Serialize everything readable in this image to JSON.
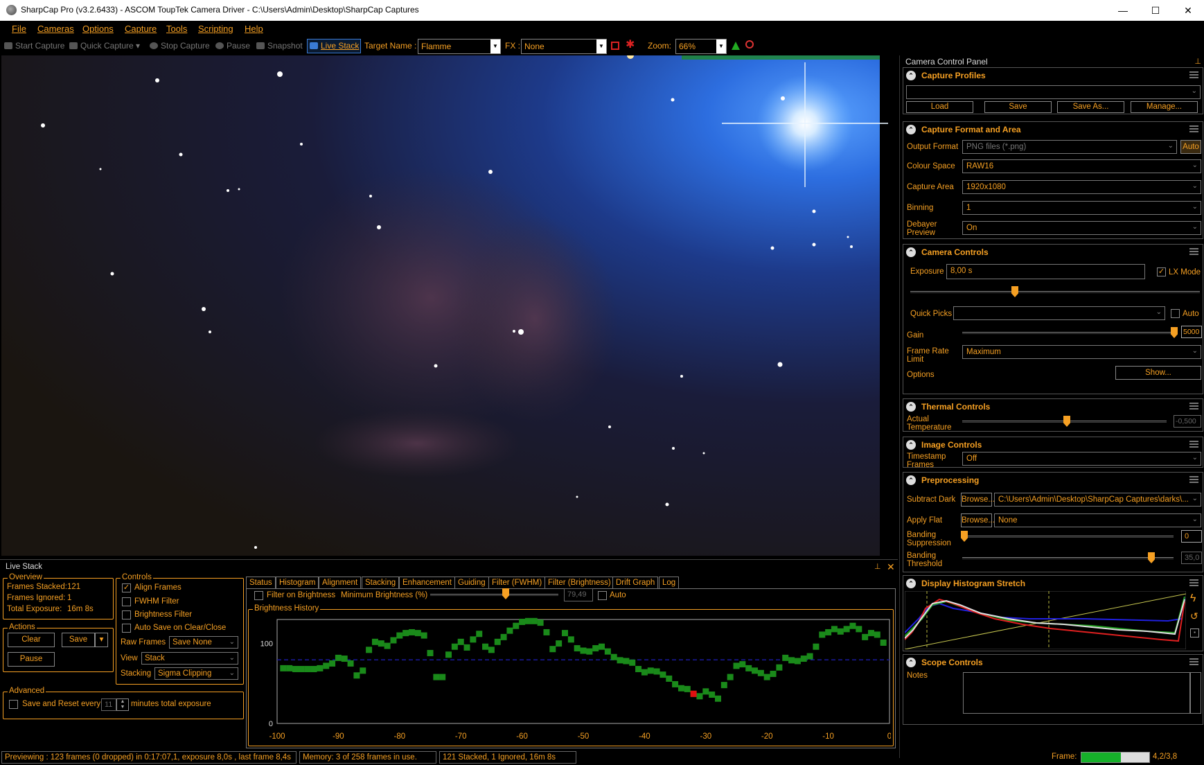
{
  "window": {
    "title": "SharpCap Pro (v3.2.6433) - ASCOM ToupTek Camera Driver - C:\\Users\\Admin\\Desktop\\SharpCap Captures",
    "minimize": "—",
    "maximize": "☐",
    "close": "✕"
  },
  "menu": [
    "File",
    "Cameras",
    "Options",
    "Capture",
    "Tools",
    "Scripting",
    "Help"
  ],
  "toolbar": {
    "start_capture": "Start Capture",
    "quick_capture": "Quick Capture",
    "stop_capture": "Stop Capture",
    "pause": "Pause",
    "snapshot": "Snapshot",
    "live_stack": "Live Stack",
    "target_name_label": "Target Name :",
    "target_name_value": "Flamme",
    "fx_label": "FX :",
    "fx_value": "None",
    "zoom_label": "Zoom:",
    "zoom_value": "66%"
  },
  "right_panel": {
    "title": "Camera Control Panel",
    "capture_profiles": {
      "title": "Capture Profiles",
      "load": "Load",
      "save": "Save",
      "save_as": "Save As...",
      "manage": "Manage..."
    },
    "capture_format": {
      "title": "Capture Format and Area",
      "output_format_label": "Output Format",
      "output_format_value": "PNG files (*.png)",
      "auto": "Auto",
      "colour_space_label": "Colour Space",
      "colour_space_value": "RAW16",
      "capture_area_label": "Capture Area",
      "capture_area_value": "1920x1080",
      "binning_label": "Binning",
      "binning_value": "1",
      "debayer_label": "Debayer Preview",
      "debayer_value": "On"
    },
    "camera_controls": {
      "title": "Camera Controls",
      "exposure_label": "Exposure",
      "exposure_value": "8,00 s",
      "lx_mode": "LX Mode",
      "quick_picks_label": "Quick Picks",
      "auto": "Auto",
      "gain_label": "Gain",
      "gain_value": "5000",
      "frame_rate_label": "Frame Rate Limit",
      "frame_rate_value": "Maximum",
      "options_label": "Options",
      "show_button": "Show..."
    },
    "thermal": {
      "title": "Thermal Controls",
      "temp_label": "Actual Temperature",
      "temp_value": "-0,500"
    },
    "image_controls": {
      "title": "Image Controls",
      "timestamp_label": "Timestamp Frames",
      "timestamp_value": "Off"
    },
    "preprocessing": {
      "title": "Preprocessing",
      "subtract_dark_label": "Subtract Dark",
      "browse": "Browse...",
      "dark_path": "C:\\Users\\Admin\\Desktop\\SharpCap Captures\\darks\\...",
      "apply_flat_label": "Apply Flat",
      "flat_value": "None",
      "banding_supp_label": "Banding Suppression",
      "banding_supp_value": "0",
      "banding_thresh_label": "Banding Threshold",
      "banding_thresh_value": "35,0"
    },
    "histogram": {
      "title": "Display Histogram Stretch"
    },
    "scope": {
      "title": "Scope Controls",
      "notes_label": "Notes"
    }
  },
  "live_stack": {
    "title": "Live Stack",
    "overview": {
      "title": "Overview",
      "frames_stacked_label": "Frames Stacked:",
      "frames_stacked_value": "121",
      "frames_ignored_label": "Frames Ignored:",
      "frames_ignored_value": "1",
      "total_exposure_label": "Total Exposure:",
      "total_exposure_value": "16m 8s"
    },
    "actions": {
      "title": "Actions",
      "clear": "Clear",
      "save": "Save",
      "pause": "Pause"
    },
    "advanced": {
      "title": "Advanced",
      "save_reset_label": "Save and Reset every",
      "save_reset_value": "11",
      "minutes_label": "minutes total exposure"
    },
    "controls": {
      "title": "Controls",
      "align_frames": "Align Frames",
      "fwhm_filter": "FWHM Filter",
      "brightness_filter": "Brightness Filter",
      "auto_save": "Auto Save on Clear/Close",
      "raw_frames_label": "Raw Frames",
      "raw_frames_value": "Save None",
      "view_label": "View",
      "view_value": "Stack",
      "stacking_label": "Stacking",
      "stacking_value": "Sigma Clipping"
    },
    "tabs": [
      "Status",
      "Histogram",
      "Alignment",
      "Stacking",
      "Enhancement",
      "Guiding",
      "Filter (FWHM)",
      "Filter (Brightness)",
      "Drift Graph",
      "Log"
    ],
    "active_tab": "Filter (Brightness)",
    "filter": {
      "filter_on_brightness": "Filter on Brightness",
      "min_brightness_label": "Minimum Brightness (%)",
      "min_brightness_value": "79,49",
      "auto": "Auto",
      "history_title": "Brightness History"
    }
  },
  "chart_data": {
    "type": "scatter",
    "title": "Brightness History",
    "xlabel": "",
    "ylabel": "",
    "xlim": [
      -100,
      0
    ],
    "ylim": [
      0,
      130
    ],
    "x_ticks": [
      "-100",
      "-90",
      "-80",
      "-70",
      "-60",
      "-50",
      "-40",
      "-30",
      "-20",
      "-10",
      "0"
    ],
    "y_ticks": [
      "0",
      "100"
    ],
    "threshold": 79.49,
    "series": [
      {
        "color": "#1a8a1a",
        "points": [
          [
            -99,
            69
          ],
          [
            -98,
            69
          ],
          [
            -97,
            68
          ],
          [
            -96,
            68
          ],
          [
            -95,
            68
          ],
          [
            -94,
            68
          ],
          [
            -93,
            69
          ],
          [
            -92,
            72
          ],
          [
            -91,
            75
          ],
          [
            -90,
            82
          ],
          [
            -89,
            81
          ],
          [
            -88,
            75
          ],
          [
            -87,
            60
          ],
          [
            -86,
            66
          ],
          [
            -85,
            92
          ],
          [
            -84,
            102
          ],
          [
            -83,
            100
          ],
          [
            -82,
            97
          ],
          [
            -81,
            104
          ],
          [
            -80,
            110
          ],
          [
            -79,
            113
          ],
          [
            -78,
            114
          ],
          [
            -77,
            113
          ],
          [
            -76,
            110
          ],
          [
            -75,
            88
          ],
          [
            -74,
            58
          ],
          [
            -73,
            58
          ],
          [
            -72,
            86
          ],
          [
            -71,
            96
          ],
          [
            -70,
            102
          ],
          [
            -69,
            95
          ],
          [
            -68,
            105
          ],
          [
            -67,
            112
          ],
          [
            -66,
            96
          ],
          [
            -65,
            92
          ],
          [
            -64,
            102
          ],
          [
            -63,
            108
          ],
          [
            -62,
            116
          ],
          [
            -61,
            122
          ],
          [
            -60,
            127
          ],
          [
            -59,
            128
          ],
          [
            -58,
            128
          ],
          [
            -57,
            126
          ],
          [
            -56,
            114
          ],
          [
            -55,
            93
          ],
          [
            -54,
            100
          ],
          [
            -53,
            113
          ],
          [
            -52,
            105
          ],
          [
            -51,
            94
          ],
          [
            -50,
            91
          ],
          [
            -49,
            90
          ],
          [
            -48,
            94
          ],
          [
            -47,
            96
          ],
          [
            -46,
            90
          ],
          [
            -45,
            83
          ],
          [
            -44,
            79
          ],
          [
            -43,
            78
          ],
          [
            -42,
            76
          ],
          [
            -41,
            68
          ],
          [
            -40,
            64
          ],
          [
            -39,
            66
          ],
          [
            -38,
            65
          ],
          [
            -37,
            61
          ],
          [
            -36,
            56
          ],
          [
            -35,
            49
          ],
          [
            -34,
            44
          ],
          [
            -33,
            43
          ],
          [
            -32,
            37
          ],
          [
            -31,
            34
          ],
          [
            -30,
            40
          ],
          [
            -29,
            36
          ],
          [
            -28,
            31
          ],
          [
            -27,
            48
          ],
          [
            -26,
            58
          ],
          [
            -25,
            72
          ],
          [
            -24,
            74
          ],
          [
            -23,
            69
          ],
          [
            -22,
            66
          ],
          [
            -21,
            63
          ],
          [
            -20,
            58
          ],
          [
            -19,
            62
          ],
          [
            -18,
            70
          ],
          [
            -17,
            82
          ],
          [
            -16,
            79
          ],
          [
            -15,
            78
          ],
          [
            -14,
            81
          ],
          [
            -13,
            84
          ],
          [
            -12,
            96
          ],
          [
            -11,
            111
          ],
          [
            -10,
            114
          ],
          [
            -9,
            118
          ],
          [
            -8,
            115
          ],
          [
            -7,
            118
          ],
          [
            -6,
            122
          ],
          [
            -5,
            118
          ],
          [
            -4,
            108
          ],
          [
            -3,
            113
          ],
          [
            -2,
            111
          ],
          [
            -1,
            101
          ]
        ]
      },
      {
        "color": "#e01010",
        "points": [
          [
            -32,
            37
          ]
        ]
      }
    ]
  },
  "status_bar": {
    "previewing": "Previewing : 123 frames (0 dropped) in 0:17:07,1, exposure 8,0s , last frame 8,4s",
    "memory": "Memory: 3 of 258 frames in use.",
    "stacked": "121 Stacked, 1 Ignored, 16m 8s",
    "frame_label": "Frame:",
    "frame_value": "4,2/3,8",
    "frame_progress": 0.58
  },
  "colors": {
    "accent": "#f6a023",
    "background": "#000000",
    "point": "#1a8a1a",
    "ignored_point": "#e01010",
    "threshold": "#1a1aa0"
  }
}
